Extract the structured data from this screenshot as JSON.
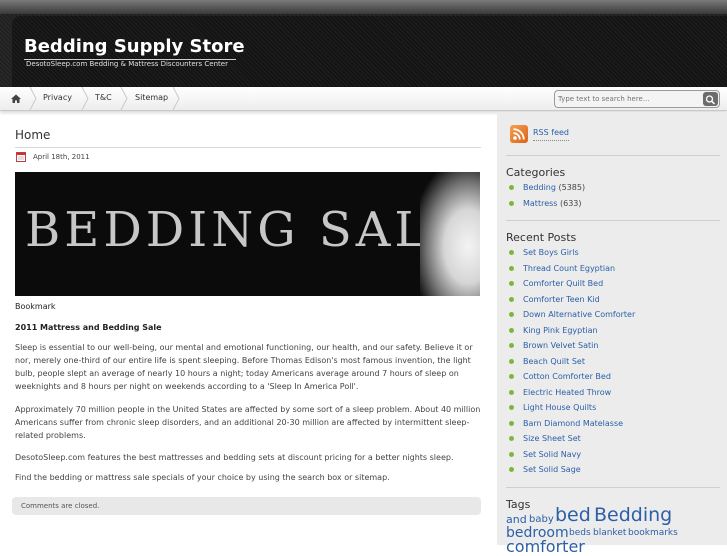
{
  "header": {
    "title": "Bedding Supply Store",
    "description": "DesotoSleep.com Bedding & Mattress Discounters Center"
  },
  "nav": {
    "items": [
      "Privacy",
      "T&C",
      "Sitemap"
    ],
    "search_placeholder": "Type text to search here..."
  },
  "post": {
    "title": "Home",
    "date": "April 18th, 2011",
    "banner_text": "BEDDING SALE",
    "bookmark": "Bookmark",
    "heading": "2011 Mattress and Bedding Sale",
    "paragraphs": [
      "Sleep is essential to our well-being, our mental and emotional functioning, our health, and our safety. Believe it or nor, merely one-third of our entire life is spent sleeping. Before Thomas Edison's most famous invention, the light bulb, people slept an average of nearly 10 hours a night; today Americans average around 7 hours of sleep on weeknights and 8 hours per night on weekends according to a 'Sleep In America Poll'.",
      "Approximately 70 million people in the United States are affected by some sort of a sleep problem. About 40 million Americans suffer from chronic sleep disorders, and an additional 20-30 million are affected by intermittent sleep-related problems.",
      "DesotoSleep.com features the best mattresses and bedding sets at discount pricing for a better nights sleep.",
      "Find the bedding or mattress sale specials of your choice by using the search box or sitemap."
    ],
    "comments_status": "Comments are closed."
  },
  "sidebar": {
    "rss_label": "RSS feed",
    "categories_title": "Categories",
    "categories": [
      {
        "name": "Bedding",
        "count": "(5385)"
      },
      {
        "name": "Mattress",
        "count": "(633)"
      }
    ],
    "recent_title": "Recent Posts",
    "recent_posts": [
      "Set Boys Girls",
      "Thread Count Egyptian",
      "Comforter Quilt Bed",
      "Comforter Teen Kid",
      "Down Alternative Comforter",
      "King Pink Egyptian",
      "Brown Velvet Satin",
      "Beach Quilt Set",
      "Cotton Comforter Bed",
      "Electric Heated Throw",
      "Light House Quilts",
      "Barn Diamond Matelasse",
      "Size Sheet Set",
      "Set Solid Navy",
      "Set Solid Sage"
    ],
    "tags_title": "Tags",
    "tags": [
      "and",
      "baby",
      "bed",
      "Bedding",
      "bedroom",
      "beds",
      "blanket",
      "bookmarks",
      "comforter"
    ]
  },
  "colors": {
    "link": "#2b5fa8",
    "bullet": "#7bb83a",
    "header_bg": "#1e1e1e",
    "rss": "#e8772a"
  }
}
